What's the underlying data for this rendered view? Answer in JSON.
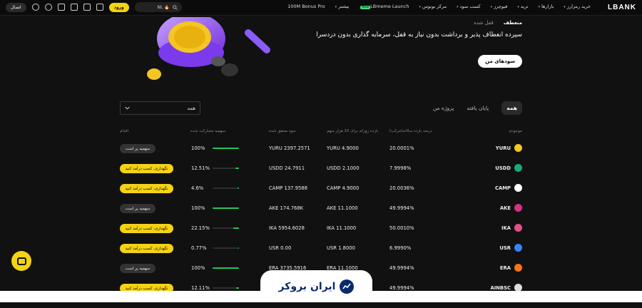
{
  "header": {
    "logo": "LBANK",
    "nav": [
      {
        "label": "خرید رمزارز",
        "caret": true
      },
      {
        "label": "بازارها",
        "caret": true
      },
      {
        "label": "ترید",
        "caret": true
      },
      {
        "label": "فیوچرز",
        "caret": true
      },
      {
        "label": "کسب سود",
        "caret": true
      },
      {
        "label": "مرکز بونوس",
        "caret": true
      },
      {
        "label": "LBmeme Launch",
        "badge": "New"
      },
      {
        "label": "بیشتر",
        "caret": true
      },
      {
        "label": "100M Bonus Pro"
      }
    ],
    "search_value": "NL 🔥",
    "login_label": "ورود",
    "connect_label": "اتصال"
  },
  "hero": {
    "tabs": [
      {
        "label": "منعطف",
        "active": true
      },
      {
        "label": "قفل شده",
        "active": false
      }
    ],
    "title": "سپرده انعطاف پذیر و برداشت بدون نیاز به قفل، سرمایه گذاری بدون دردسرا",
    "cta": "سودهای من"
  },
  "filters": {
    "tabs": [
      {
        "label": "همه",
        "active": true
      },
      {
        "label": "پایان یافته",
        "active": false
      },
      {
        "label": "پروژه من",
        "active": false
      }
    ],
    "select_value": "همه"
  },
  "table": {
    "columns": [
      "موجودی",
      "درصد بازده سالانه(مرکب)",
      "بازده روزانه برای 10 هزار سهم",
      "سود محقق شده",
      "سهمیه مشارکت شده",
      "اقدام"
    ],
    "rows": [
      {
        "coin": "YURU",
        "apr": "20.0001%",
        "daily": "YURU 4.9000",
        "realized": "YURU 2397.2571",
        "quota": "100%",
        "quota_fill": 1.0,
        "action": "سهمیه پر است",
        "action_type": "gray",
        "coin_color": "#f3c623"
      },
      {
        "coin": "USDD",
        "apr": "7.9998%",
        "daily": "USDD 2.1000",
        "realized": "USDD 24.7911",
        "quota": "12.51%",
        "quota_fill": 0.1251,
        "action": "نگهداری، کسب درآمد کنید",
        "action_type": "yellow",
        "coin_color": "#1aa97c"
      },
      {
        "coin": "CAMP",
        "apr": "20.0036%",
        "daily": "CAMP 4.9000",
        "realized": "CAMP 137.9588",
        "quota": "4.6%",
        "quota_fill": 0.046,
        "action": "نگهداری، کسب درآمد کنید",
        "action_type": "yellow",
        "coin_color": "#ffffff"
      },
      {
        "coin": "AKE",
        "apr": "49.9994%",
        "daily": "AKE 11.1000",
        "realized": "AKE 174.768K",
        "quota": "100%",
        "quota_fill": 1.0,
        "action": "سهمیه پر است",
        "action_type": "gray",
        "coin_color": "#d63384"
      },
      {
        "coin": "IKA",
        "apr": "50.0010%",
        "daily": "IKA 11.1000",
        "realized": "IKA 5954.6028",
        "quota": "22.15%",
        "quota_fill": 0.2215,
        "action": "نگهداری، کسب درآمد کنید",
        "action_type": "yellow",
        "coin_color": "#e84d8a"
      },
      {
        "coin": "USR",
        "apr": "6.9990%",
        "daily": "USR 1.8000",
        "realized": "USR 0.00",
        "quota": "0.77%",
        "quota_fill": 0.0077,
        "action": "نگهداری، کسب درآمد کنید",
        "action_type": "yellow",
        "coin_color": "#3b82f6"
      },
      {
        "coin": "ERA",
        "apr": "49.9994%",
        "daily": "ERA 11.1000",
        "realized": "ERA 3735.5916",
        "quota": "100%",
        "quota_fill": 1.0,
        "action": "سهمیه پر است",
        "action_type": "gray",
        "coin_color": "#f97316"
      },
      {
        "coin": "AINBSC",
        "apr": "49.9994%",
        "daily": "",
        "realized": "",
        "quota": "12.11%",
        "quota_fill": 0.1211,
        "action": "نگهداری، کسب درآمد کنید",
        "action_type": "yellow",
        "coin_color": "#dddddd"
      }
    ]
  },
  "watermark": {
    "text": "ایران بروکر"
  },
  "icons": [
    "globe-icon",
    "download-icon",
    "document-icon",
    "wallet-icon",
    "profile-icon",
    "search-icon",
    "chat-icon",
    "chevron-down-icon"
  ]
}
